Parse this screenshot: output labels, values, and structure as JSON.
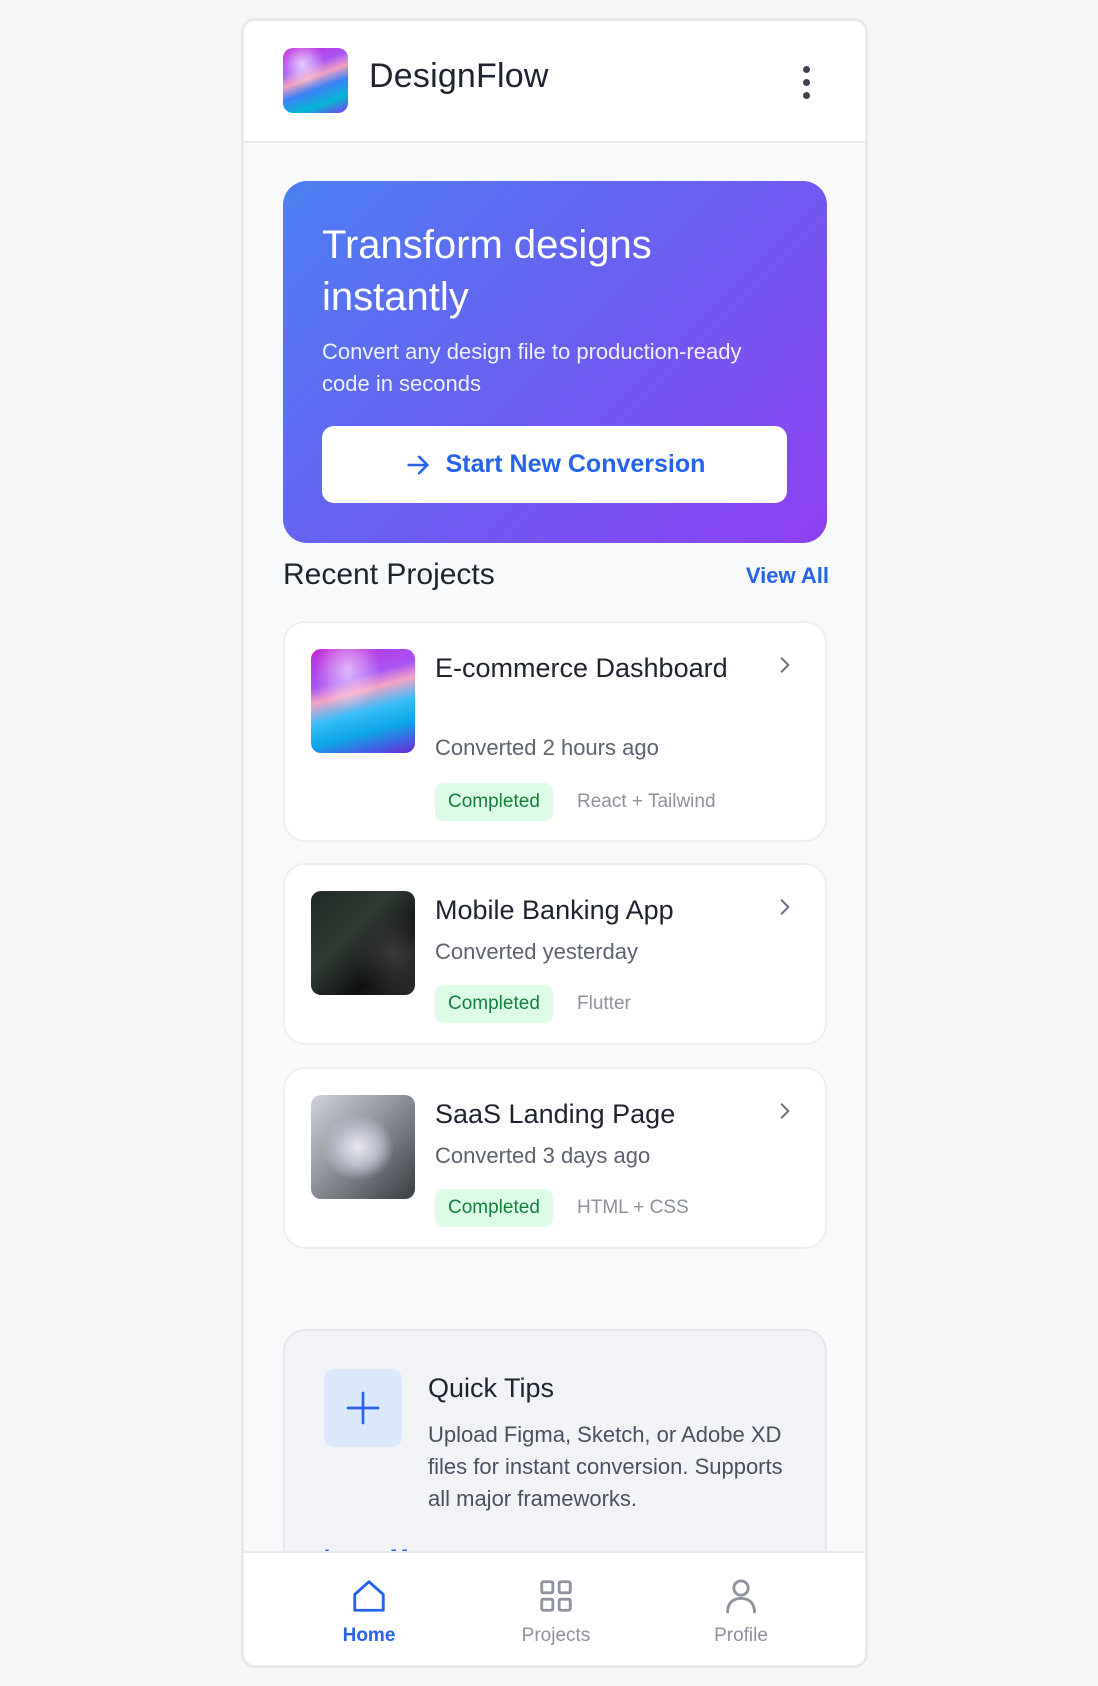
{
  "header": {
    "app_name": "DesignFlow",
    "logo_icon": "app-logo",
    "menu_icon": "more-vertical-icon"
  },
  "hero": {
    "title": "Transform designs instantly",
    "subtitle": "Convert any design file to production-ready code in seconds",
    "button_label": "Start New Conversion",
    "button_icon": "arrow-right-icon",
    "gradient_start": "#4b80f2",
    "gradient_end": "#8f3ff0"
  },
  "recent": {
    "title": "Recent Projects",
    "view_all": "View All",
    "projects": [
      {
        "name": "E-commerce Dashboard",
        "converted": "Converted 2 hours ago",
        "status": "Completed",
        "tech": "React + Tailwind"
      },
      {
        "name": "Mobile Banking App",
        "converted": "Converted yesterday",
        "status": "Completed",
        "tech": "Flutter"
      },
      {
        "name": "SaaS Landing Page",
        "converted": "Converted 3 days ago",
        "status": "Completed",
        "tech": "HTML + CSS"
      }
    ]
  },
  "tips": {
    "title": "Quick Tips",
    "text": "Upload Figma, Sketch, or Adobe XD files for instant conversion. Supports all major frameworks.",
    "learn_more": "Learn More",
    "icon": "plus-icon"
  },
  "nav": {
    "items": [
      {
        "label": "Home",
        "icon": "home-icon",
        "active": true
      },
      {
        "label": "Projects",
        "icon": "grid-icon",
        "active": false
      },
      {
        "label": "Profile",
        "icon": "user-icon",
        "active": false
      }
    ]
  },
  "colors": {
    "accent": "#2563eb",
    "success_bg": "#dcfce7",
    "success_text": "#15803d"
  }
}
